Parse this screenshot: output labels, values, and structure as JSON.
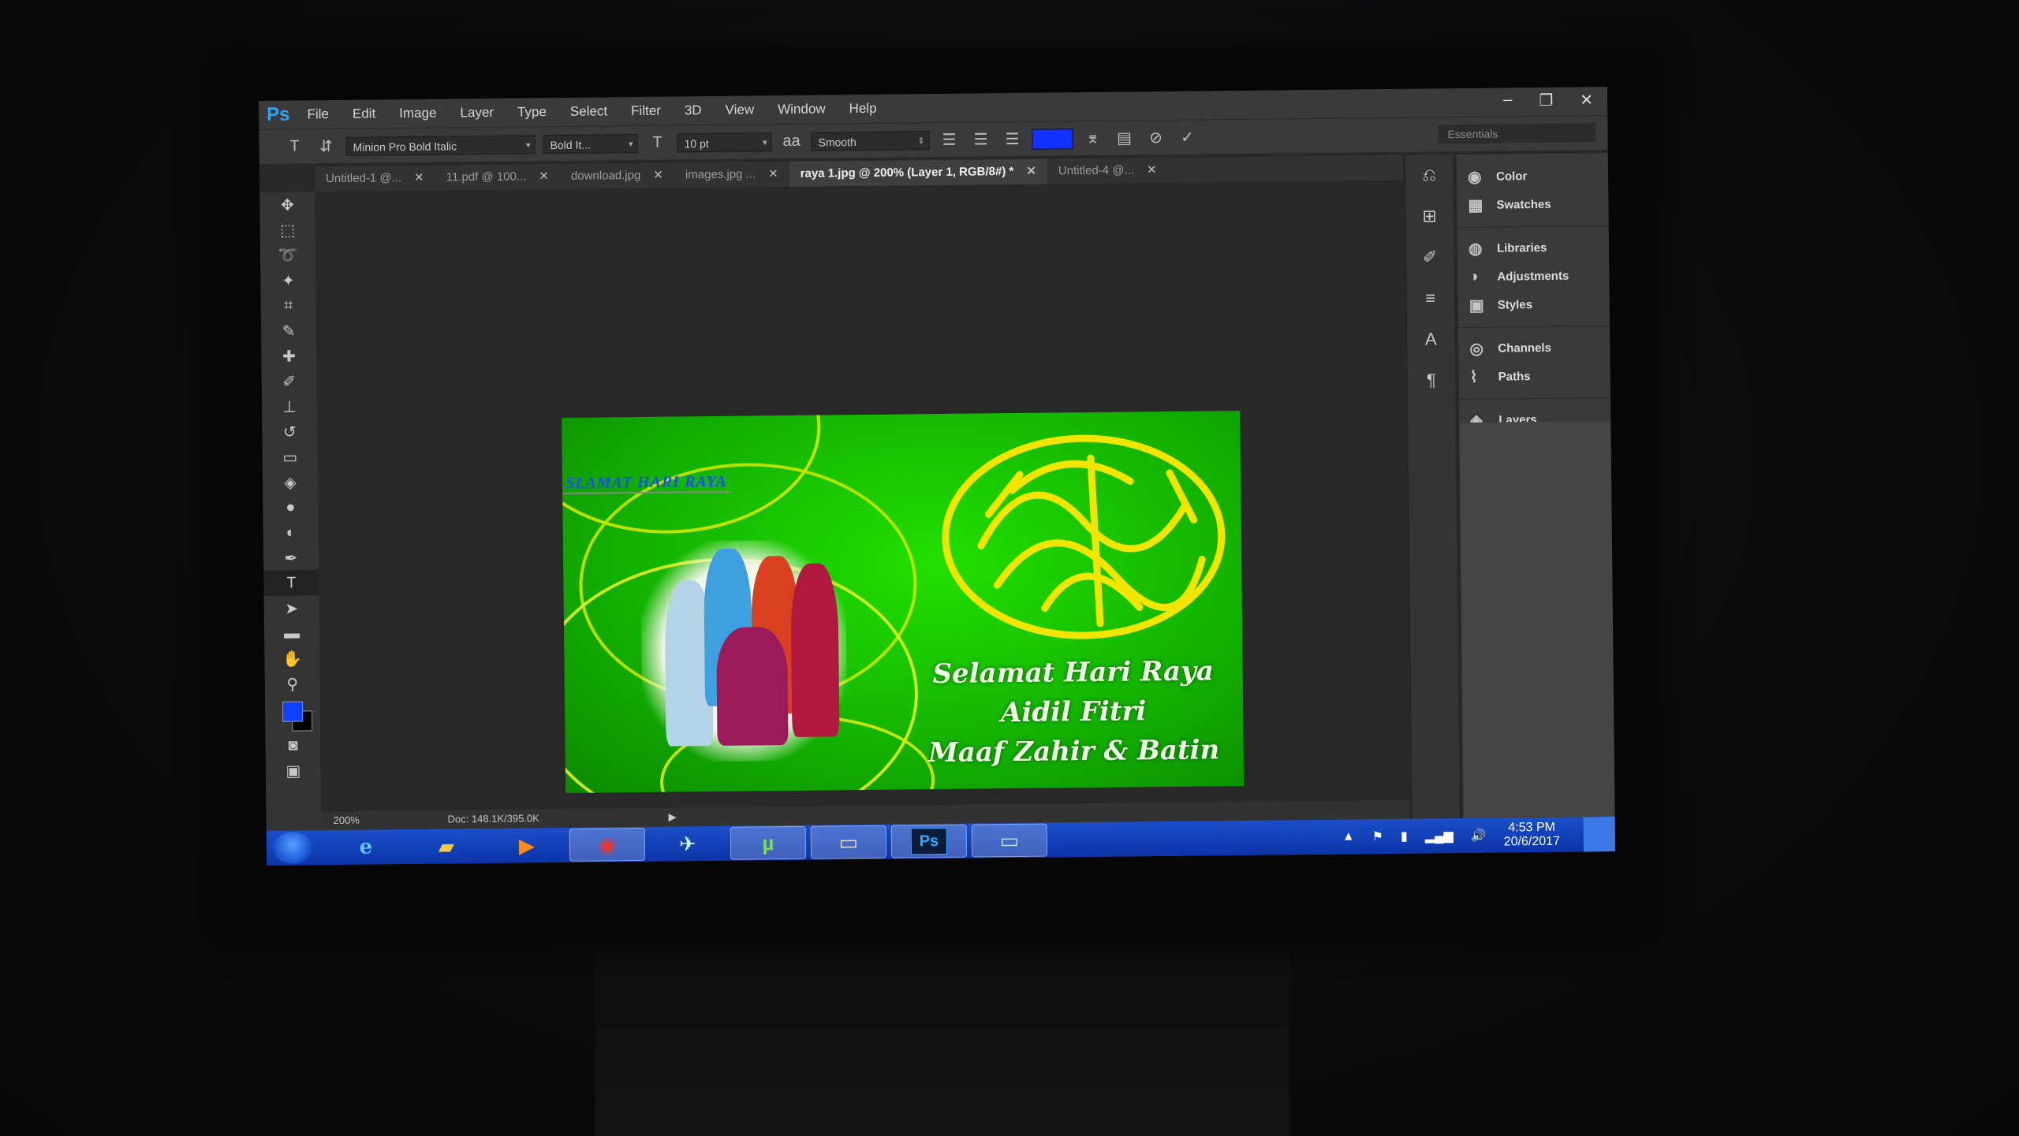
{
  "app": {
    "logo": "Ps",
    "menu": [
      "File",
      "Edit",
      "Image",
      "Layer",
      "Type",
      "Select",
      "Filter",
      "3D",
      "View",
      "Window",
      "Help"
    ],
    "window_controls": [
      "–",
      "❐",
      "✕"
    ]
  },
  "options_bar": {
    "font_family": "Minion Pro Bold Italic",
    "font_style": "Bold It...",
    "font_size": "10 pt",
    "anti_alias_glyph": "aa",
    "anti_alias": "Smooth",
    "text_color": "#1133ff",
    "workspace": "Essentials"
  },
  "tabs": [
    {
      "label": "Untitled-1 @...",
      "active": false
    },
    {
      "label": "11.pdf @ 100...",
      "active": false
    },
    {
      "label": "download.jpg",
      "active": false
    },
    {
      "label": "images.jpg ...",
      "active": false
    },
    {
      "label": "raya 1.jpg @ 200% (Layer 1, RGB/8#) *",
      "active": true
    },
    {
      "label": "Untitled-4 @...",
      "active": false
    }
  ],
  "document": {
    "typed_text": "SLAMAT HARI RAYA",
    "greeting_lines": [
      "Selamat Hari Raya",
      "Aidil Fitri",
      "Maaf Zahir & Batin"
    ],
    "background_color": "#14b400"
  },
  "status_bar": {
    "zoom": "200%",
    "doc_size": "Doc: 148.1K/395.0K"
  },
  "panels": [
    {
      "label": "Color",
      "icon": "color-palette-icon"
    },
    {
      "label": "Swatches",
      "icon": "swatches-grid-icon"
    },
    {
      "label": "Libraries",
      "icon": "libraries-icon"
    },
    {
      "label": "Adjustments",
      "icon": "adjustments-icon"
    },
    {
      "label": "Styles",
      "icon": "styles-icon"
    },
    {
      "label": "Channels",
      "icon": "channels-icon"
    },
    {
      "label": "Paths",
      "icon": "paths-icon"
    },
    {
      "label": "Layers",
      "icon": "layers-icon"
    }
  ],
  "taskbar": {
    "ps_label": "Ps",
    "clock_time": "4:53 PM",
    "clock_date": "20/6/2017"
  }
}
